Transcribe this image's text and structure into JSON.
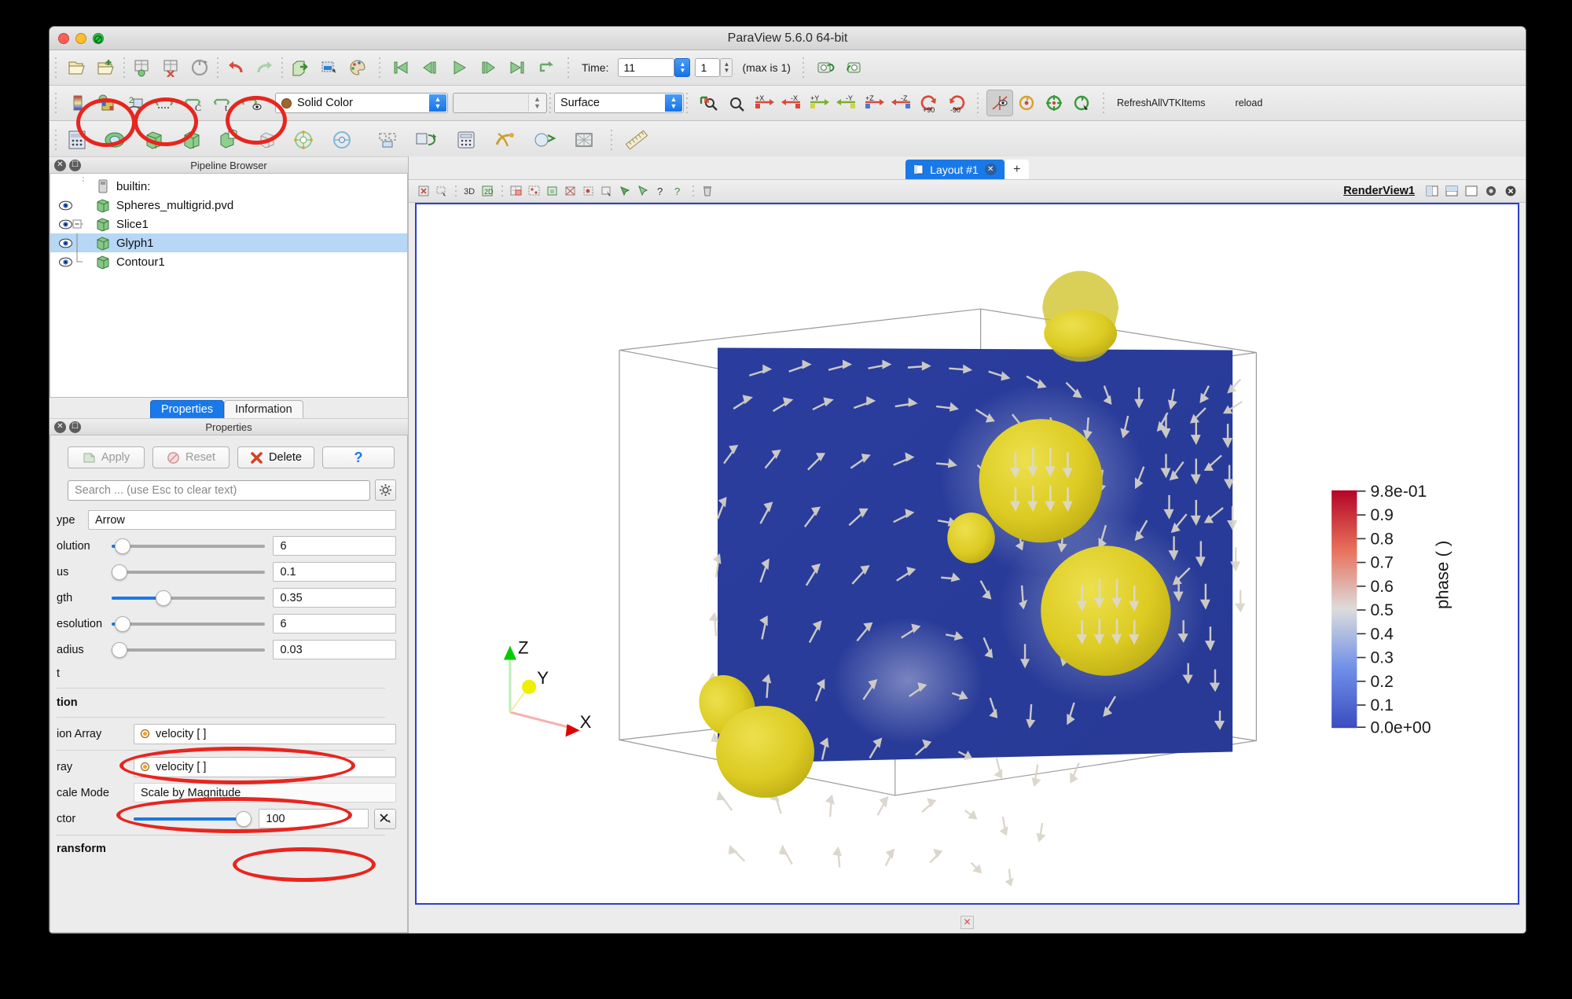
{
  "window": {
    "title": "ParaView 5.6.0 64-bit"
  },
  "toolbar_main": {
    "time_label": "Time:",
    "time_value": "11",
    "frame_value": "1",
    "max_text": "(max is 1)",
    "icons": [
      "open-file-icon",
      "open-recent-icon",
      "save-state-icon",
      "load-state-icon",
      "reset-session-icon",
      "undo-icon",
      "redo-icon",
      "export-scene-icon",
      "screenshot-icon",
      "color-palette-icon",
      "first-frame-icon",
      "previous-frame-icon",
      "play-icon",
      "next-frame-icon",
      "last-frame-icon",
      "loop-icon",
      "camera-undo-icon",
      "camera-redo-icon"
    ]
  },
  "toolbar_repr": {
    "color_by": "Solid Color",
    "color_by_icon": "solid-color-dot",
    "component_select": "",
    "representation": "Surface",
    "macro_refresh": "RefreshAllVTKItems",
    "macro_reload": "reload",
    "icons": [
      "edit-color-map-icon",
      "rescale-to-data-icon",
      "rescale-custom-icon",
      "rescale-to-range-icon",
      "rescale-over-time-icon",
      "rescale-visible-icon",
      "zoom-to-box-icon",
      "reset-camera-icon",
      "plus-x-icon",
      "minus-x-icon",
      "plus-y-icon",
      "minus-y-icon",
      "plus-z-icon",
      "minus-z-icon",
      "rotate-90-ccw-icon",
      "rotate-90-cw-icon",
      "center-axes-icon",
      "reset-center-icon",
      "pick-center-icon",
      "show-center-icon",
      "toggle-center-icon"
    ]
  },
  "toolbar_filters": {
    "icons": [
      "spreadsheet-icon",
      "slice-icon",
      "clip-icon",
      "extract-subset-icon",
      "threshold-icon",
      "glyph-icon",
      "stream-tracer-icon",
      "warp-icon",
      "group-datasets-icon",
      "extract-level-icon",
      "calculator-icon",
      "python-calculator-icon",
      "gradient-icon",
      "mesh-quality-icon",
      "contour-icon",
      "ruler-icon"
    ]
  },
  "pipeline": {
    "dock_title": "Pipeline Browser",
    "items": [
      {
        "label": "builtin:",
        "icon": "server-icon",
        "eye": false,
        "depth": 0,
        "selected": false
      },
      {
        "label": "Spheres_multigrid.pvd",
        "icon": "source-icon",
        "eye": true,
        "depth": 0,
        "selected": false
      },
      {
        "label": "Slice1",
        "icon": "source-icon",
        "eye": true,
        "depth": 1,
        "selected": false,
        "expander": "minus"
      },
      {
        "label": "Glyph1",
        "icon": "source-icon",
        "eye": true,
        "depth": 2,
        "selected": true
      },
      {
        "label": "Contour1",
        "icon": "source-icon",
        "eye": true,
        "depth": 2,
        "selected": false
      }
    ]
  },
  "tabs": [
    {
      "label": "Properties",
      "active": true
    },
    {
      "label": "Information",
      "active": false
    }
  ],
  "properties": {
    "dock_title": "Properties",
    "apply": "Apply",
    "reset": "Reset",
    "delete": "Delete",
    "help": "?",
    "search_placeholder": "Search ... (use Esc to clear text)",
    "gear_icon": "gear-icon",
    "rows": [
      {
        "kind": "combo",
        "label": "ype",
        "value": "Arrow"
      },
      {
        "kind": "slider",
        "label": "olution",
        "value": "6",
        "fill": 4,
        "knob": 4
      },
      {
        "kind": "slider",
        "label": "us",
        "value": "0.1",
        "fill": 1,
        "knob": 1
      },
      {
        "kind": "slider",
        "label": "gth",
        "value": "0.35",
        "fill": 35,
        "knob": 35
      },
      {
        "kind": "slider",
        "label": "esolution",
        "value": "6",
        "fill": 4,
        "knob": 4
      },
      {
        "kind": "slider",
        "label": "adius",
        "value": "0.03",
        "fill": 1,
        "knob": 1
      },
      {
        "kind": "plain",
        "label": "t",
        "value": ""
      },
      {
        "kind": "header",
        "label": "tion",
        "value": ""
      },
      {
        "kind": "array",
        "label": "ion Array",
        "value": "velocity [ ]"
      },
      {
        "kind": "array",
        "label": "ray",
        "value": "velocity [ ]"
      },
      {
        "kind": "combo2",
        "label": "cale Mode",
        "value": "Scale by Magnitude"
      },
      {
        "kind": "factor",
        "label": "ctor",
        "value": "100",
        "fill": 78,
        "knob": 78
      },
      {
        "kind": "header",
        "label": "ransform",
        "value": ""
      }
    ]
  },
  "layout": {
    "tab_label": "Layout #1",
    "tab_close_icon": "close-icon",
    "add_tab_label": "+",
    "view_name": "RenderView1",
    "view_buttons": [
      "split-horizontal-icon",
      "split-vertical-icon",
      "maximize-icon",
      "capture-icon",
      "close-view-icon"
    ],
    "view_toolbar_icons": [
      "interaction-mode-icon",
      "select-cells-icon",
      "mode-3d-icon",
      "mode-2d-icon",
      "select-surface-cells-icon",
      "select-surface-points-icon",
      "select-frustum-cells-icon",
      "select-block-icon",
      "select-points-through-icon",
      "hover-cells-icon",
      "hover-points-icon",
      "interactive-select-icon",
      "zoom-closest-icon",
      "plot-over-line-icon",
      "quartile-chart-icon",
      "select-help-icon",
      "select-query-icon",
      "clear-selection-icon"
    ]
  },
  "scalebar": {
    "title": "phase ( )",
    "ticks": [
      "9.8e-01",
      "0.9",
      "0.8",
      "0.7",
      "0.6",
      "0.5",
      "0.4",
      "0.3",
      "0.2",
      "0.1",
      "0.0e+00"
    ],
    "color_high": "#b40426",
    "color_mid": "#dddddd",
    "color_low": "#3b4cc0"
  },
  "orientation_axes": {
    "x": "X",
    "y": "Y",
    "z": "Z"
  },
  "annotations": {
    "note": "red-ellipse-highlights",
    "count": 6
  },
  "statusbar": {
    "icon": "busy-icon"
  }
}
